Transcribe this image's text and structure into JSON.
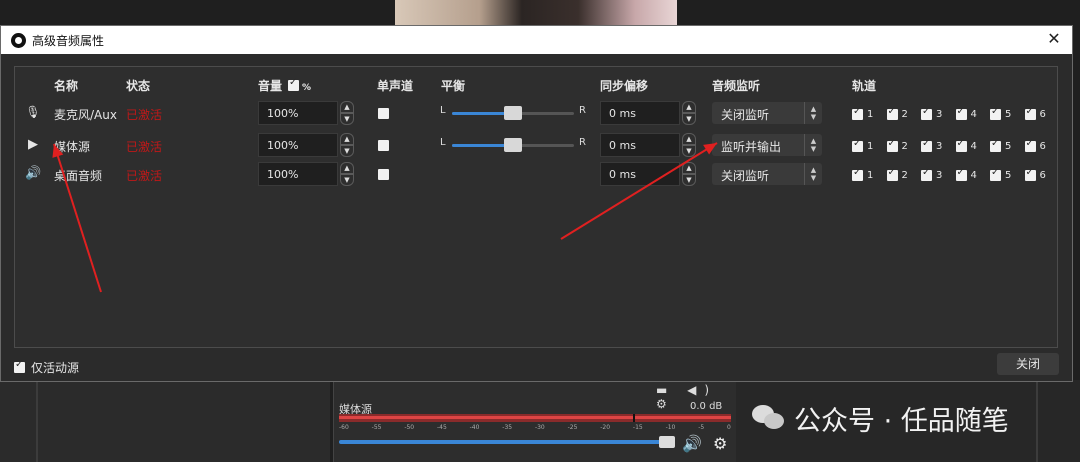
{
  "dialog": {
    "title": "高级音频属性",
    "close_glyph": "✕"
  },
  "columns": {
    "name": "名称",
    "status": "状态",
    "volume": "音量",
    "volume_percent": "%",
    "mono": "单声道",
    "balance": "平衡",
    "sync_offset": "同步偏移",
    "monitoring": "音频监听",
    "tracks": "轨道"
  },
  "sources": [
    {
      "icon": "microphone-icon",
      "name": "麦克风/Aux",
      "status": "已激活",
      "volume": "100%",
      "mono": false,
      "balance_left": "L",
      "balance_right": "R",
      "balance_value": 0.5,
      "sync": "0 ms",
      "monitoring": "关闭监听",
      "tracks": [
        "1",
        "2",
        "3",
        "4",
        "5",
        "6"
      ]
    },
    {
      "icon": "play-icon",
      "name": "媒体源",
      "status": "已激活",
      "volume": "100%",
      "mono": false,
      "balance_left": "L",
      "balance_right": "R",
      "balance_value": 0.5,
      "sync": "0 ms",
      "monitoring": "监听并输出",
      "tracks": [
        "1",
        "2",
        "3",
        "4",
        "5",
        "6"
      ]
    },
    {
      "icon": "speaker-icon",
      "name": "桌面音频",
      "status": "已激活",
      "volume": "100%",
      "mono": false,
      "sync": "0 ms",
      "monitoring": "关闭监听",
      "tracks": [
        "1",
        "2",
        "3",
        "4",
        "5",
        "6"
      ]
    }
  ],
  "footer": {
    "active_only_label": "仅活动源",
    "active_only_checked": true,
    "close_button": "关闭"
  },
  "background": {
    "mixer_source_name": "媒体源",
    "mixer_db": "0.0 dB",
    "mixer_scale": [
      "-60",
      "-55",
      "-50",
      "-45",
      "-40",
      "-35",
      "-30",
      "-25",
      "-20",
      "-15",
      "-10",
      "-5",
      "0"
    ],
    "mixer_icons": "▬ ◀) ⚙",
    "mixer_fader_value": 1.0,
    "watermark": "公众号 · 任品随笔"
  },
  "colors": {
    "status_active": "#c01818",
    "slider_blue": "#3a86d6",
    "annotation_arrow": "#e02020"
  }
}
